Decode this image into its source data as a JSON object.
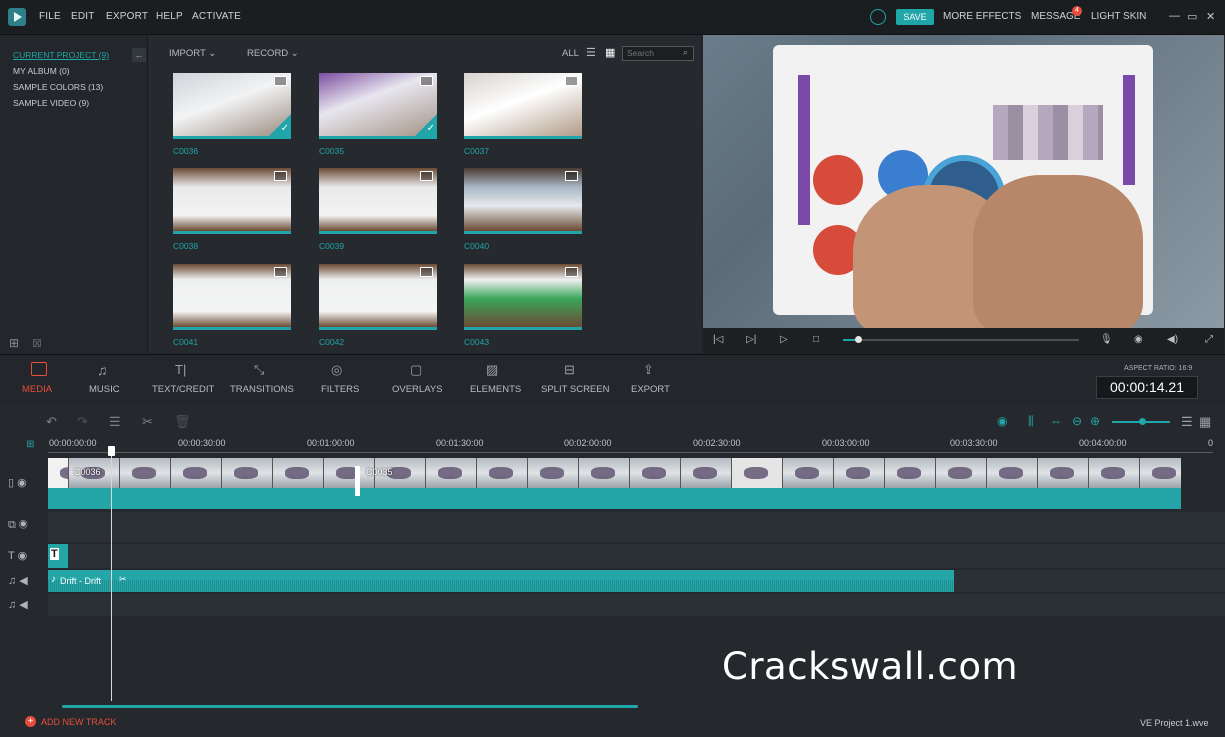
{
  "topbar": {
    "menu": [
      "FILE",
      "EDIT",
      "EXPORT",
      "HELP",
      "ACTIVATE"
    ],
    "save": "SAVE",
    "more_effects": "MORE EFFECTS",
    "message": "MESSAGE",
    "message_count": "4",
    "light_skin": "LIGHT SKIN"
  },
  "library": {
    "items": [
      "CURRENT PROJECT (9)",
      "MY ALBUM (0)",
      "SAMPLE COLORS (13)",
      "SAMPLE VIDEO (9)"
    ]
  },
  "media": {
    "import": "IMPORT",
    "record": "RECORD",
    "all": "ALL",
    "search_placeholder": "Search",
    "clips": [
      {
        "name": "C0036",
        "checked": true
      },
      {
        "name": "C0035",
        "checked": true
      },
      {
        "name": "C0037",
        "checked": false
      },
      {
        "name": "C0038",
        "checked": false
      },
      {
        "name": "C0039",
        "checked": false
      },
      {
        "name": "C0040",
        "checked": false
      },
      {
        "name": "C0041",
        "checked": false
      },
      {
        "name": "C0042",
        "checked": false
      },
      {
        "name": "C0043",
        "checked": false
      }
    ]
  },
  "tools": [
    "MEDIA",
    "MUSIC",
    "TEXT/CREDIT",
    "TRANSITIONS",
    "FILTERS",
    "OVERLAYS",
    "ELEMENTS",
    "SPLIT SCREEN",
    "EXPORT"
  ],
  "aspect_ratio": "ASPECT RATIO: 16:9",
  "timecode": "00:00:14.21",
  "ruler": [
    "00:00:00:00",
    "00:00:30:00",
    "00:01:00:00",
    "00:01:30:00",
    "00:02:00:00",
    "00:02:30:00",
    "00:03:00:00",
    "00:03:30:00",
    "00:04:00:00",
    "0"
  ],
  "timeline": {
    "clip_1": "C0036",
    "clip_2": "C0035",
    "audio_clip": "Drift - Drift",
    "text_clip": "T"
  },
  "add_track": "ADD NEW TRACK",
  "project_name": "VE Project 1.wve",
  "watermark": "Crackswall.com",
  "colors": {
    "accent": "#20a5a8",
    "badge": "#e74c3c",
    "tool_active": "#e74c3c"
  }
}
